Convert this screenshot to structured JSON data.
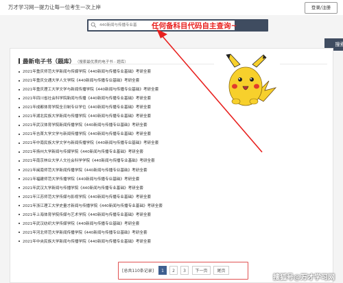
{
  "header": {
    "site_title": "万才学习网—提力让每一位考生一次上岸",
    "login_label": "登录/注册"
  },
  "search": {
    "placeholder": "440新闻与传播专业基",
    "button_label": "搜索"
  },
  "annotation": {
    "text": "任何备科目代码自主查询~",
    "color": "#e8211f"
  },
  "section": {
    "title": "最新电子书（题库）",
    "subtitle": "（搜索最优质的电子书 - 题库）"
  },
  "books": [
    "2021年重庆师范大学新闻与传媒学院《440新闻与传播专业基础》考研全套",
    "2021年重庆交通大学人文学院《440新闻与传播专业基础》考研全套",
    "2021年重庆理工大学文学与新闻传播学院《440新闻与传播专业基础》考研全套",
    "2021年四川省社会科学院新闻与传播《440新闻与传播专业基础》考研全套",
    "2021年成都体育学院全日制专业学位《440新闻与传播专业基础》考研全套",
    "2021年湖北民族大学新闻与传播学院《440新闻与传播专业基础》考研全套",
    "2021年武汉体育学院新闻传播学院《440新闻与传播专业基础》考研全套",
    "2021年吉首大学文学与新闻传播学院《440新闻与传播专业基础》考研全套",
    "2021年中南民族大学文学与新闻传播学院《440新闻与传播专业基础》考研全套",
    "2021年扬州大学新闻与传媒学院《440新闻与传播专业基础》考研全套",
    "2021年南京林业大学人文社会科学学院《440新闻与传播专业基础》考研全套",
    "2021年闽南师范大学新闻传播学院《440新闻与传播专业基础》考研全套",
    "2021年福建师范大学传播学院《440新闻与传播专业基础》考研全套",
    "2021年武汉大学新闻与传播学院《440新闻与传播专业基础》考研全套",
    "2021年江苏师范大学传媒与影视学院《440新闻与传播专业基础》考研全套",
    "2021年浙江理工大学史量才新闻与传播学院《440新闻与传播专业基础》考研全套",
    "2021年上海体育学院传媒与艺术学院《440新闻与传播专业基础》考研全套",
    "2021年武汉纺织大学传媒学院《440新闻与传播专业基础》考研全套",
    "2021年河北师范大学新闻传播学院《440新闻与传播专业基础》考研全套",
    "2021年中央民族大学新闻与传播学院《440新闻与传播专业基础》考研全套"
  ],
  "pagination": {
    "total_label": "[总共110条记录]",
    "pages": [
      "1",
      "2",
      "3"
    ],
    "current_page": 1,
    "next_label": "下一页",
    "last_label": "尾页"
  },
  "watermark": "搜狐号@万才学习网",
  "colors": {
    "search_bar": "#3f4c60",
    "active_page": "#3f5f8f",
    "annotation_red": "#e8211f"
  }
}
